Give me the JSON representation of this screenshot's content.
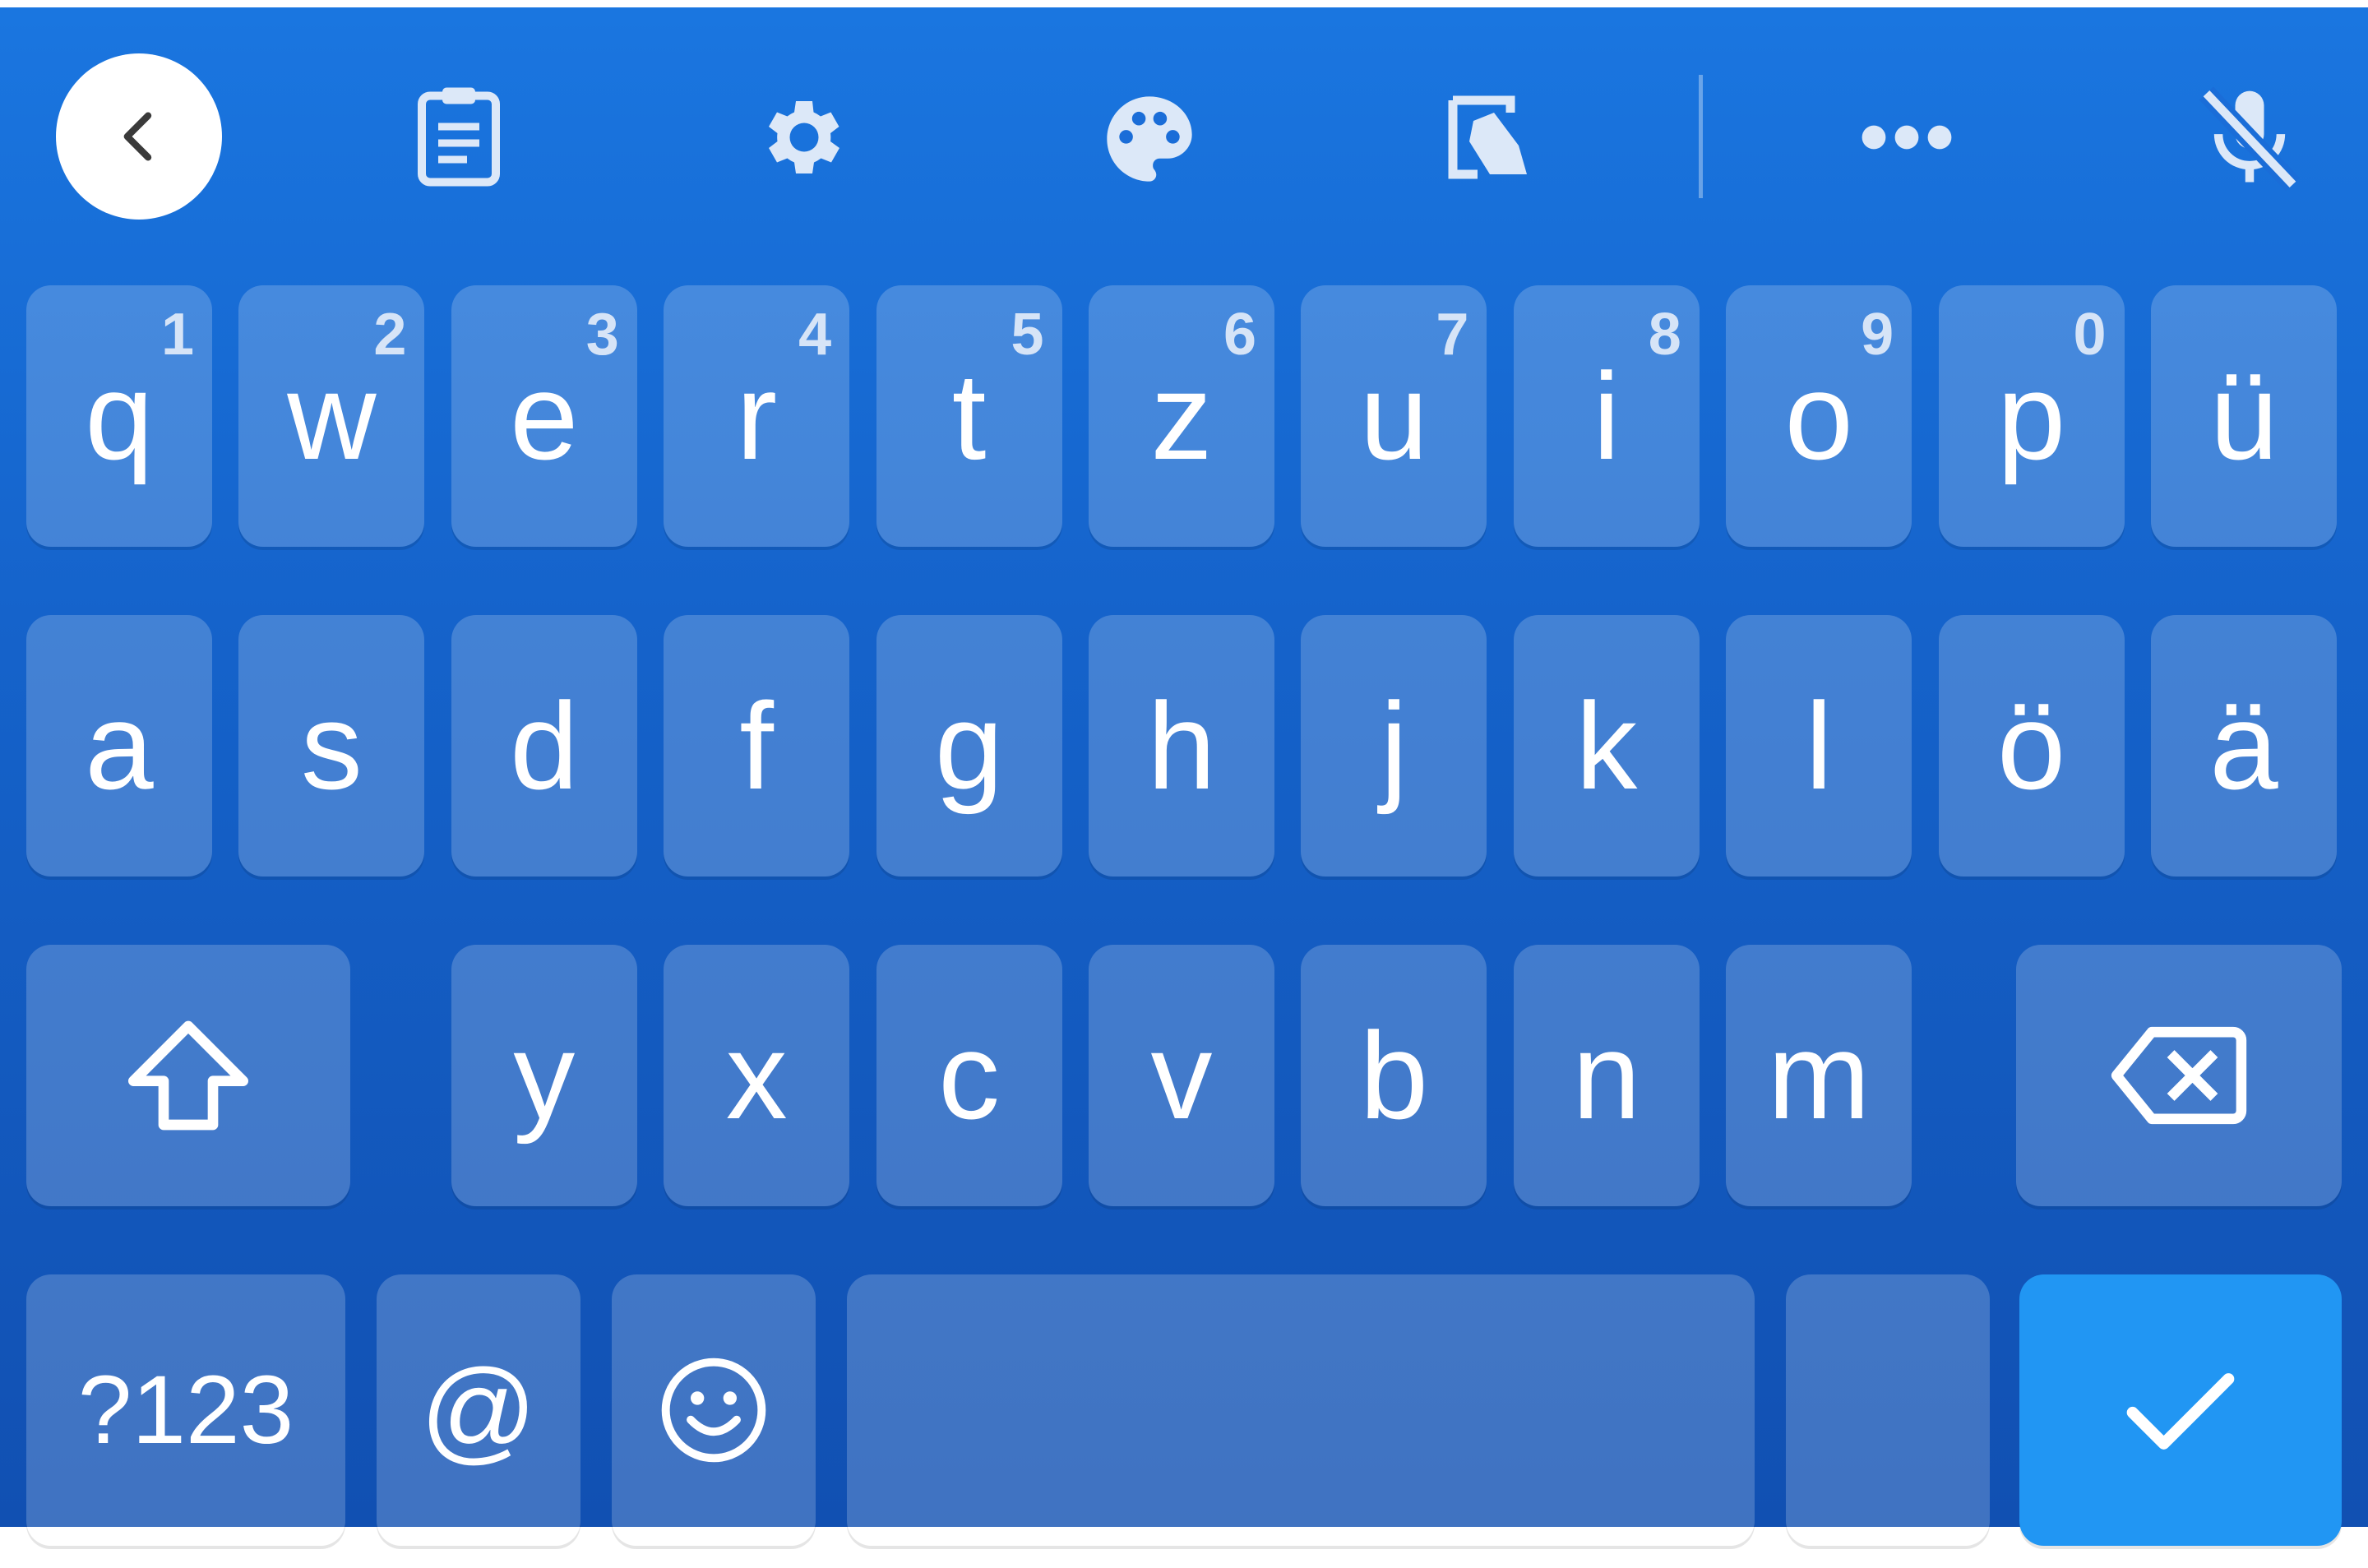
{
  "colors": {
    "accent": "#2196f3",
    "background_top": "#1a76e0",
    "background_bottom": "#1150b2",
    "key": "rgba(255,255,255,0.2)",
    "text": "#ffffff"
  },
  "toolbar": {
    "items": [
      {
        "name": "back-button",
        "icon": "chevron-left-icon"
      },
      {
        "name": "clipboard-button",
        "icon": "clipboard-icon"
      },
      {
        "name": "settings-button",
        "icon": "gear-icon"
      },
      {
        "name": "theme-button",
        "icon": "palette-icon"
      },
      {
        "name": "one-handed-button",
        "icon": "one-handed-mode-icon"
      },
      {
        "name": "more-button",
        "icon": "more-horizontal-icon"
      },
      {
        "name": "voice-input-button",
        "icon": "mic-off-icon"
      }
    ]
  },
  "rows": {
    "row1": [
      {
        "label": "q",
        "hint": "1"
      },
      {
        "label": "w",
        "hint": "2"
      },
      {
        "label": "e",
        "hint": "3"
      },
      {
        "label": "r",
        "hint": "4"
      },
      {
        "label": "t",
        "hint": "5"
      },
      {
        "label": "z",
        "hint": "6"
      },
      {
        "label": "u",
        "hint": "7"
      },
      {
        "label": "i",
        "hint": "8"
      },
      {
        "label": "o",
        "hint": "9"
      },
      {
        "label": "p",
        "hint": "0"
      },
      {
        "label": "ü",
        "hint": ""
      }
    ],
    "row2": [
      {
        "label": "a"
      },
      {
        "label": "s"
      },
      {
        "label": "d"
      },
      {
        "label": "f"
      },
      {
        "label": "g"
      },
      {
        "label": "h"
      },
      {
        "label": "j"
      },
      {
        "label": "k"
      },
      {
        "label": "l"
      },
      {
        "label": "ö"
      },
      {
        "label": "ä"
      }
    ],
    "row3": [
      {
        "label": "y"
      },
      {
        "label": "x"
      },
      {
        "label": "c"
      },
      {
        "label": "v"
      },
      {
        "label": "b"
      },
      {
        "label": "n"
      },
      {
        "label": "m"
      }
    ],
    "row4": {
      "symbols_label": "?123",
      "at_label": "@",
      "period_label": ".",
      "emoji_icon": "smiley-icon",
      "enter_icon": "checkmark-icon",
      "shift_icon": "shift-arrow-icon",
      "backspace_icon": "backspace-icon"
    }
  }
}
